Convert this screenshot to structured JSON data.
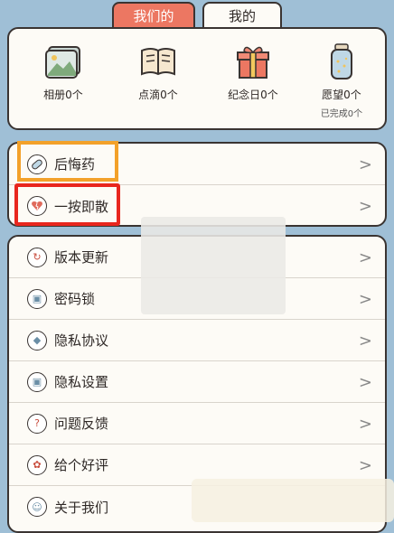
{
  "tabs": {
    "active": "我们的",
    "inactive": "我的"
  },
  "stats": [
    {
      "label": "相册0个",
      "icon": "photo-album-icon"
    },
    {
      "label": "点滴0个",
      "icon": "book-icon"
    },
    {
      "label": "纪念日0个",
      "icon": "gift-icon"
    },
    {
      "label": "愿望0个",
      "sub": "已完成0个",
      "icon": "wish-jar-icon"
    }
  ],
  "mid_rows": [
    {
      "label": "后悔药",
      "icon": "pill-icon"
    },
    {
      "label": "一按即散",
      "icon": "broken-heart-icon"
    }
  ],
  "menu_rows": [
    {
      "label": "版本更新",
      "icon": "update-icon"
    },
    {
      "label": "密码锁",
      "icon": "lock-icon"
    },
    {
      "label": "隐私协议",
      "icon": "shield-icon"
    },
    {
      "label": "隐私设置",
      "icon": "privacy-lock-icon"
    },
    {
      "label": "问题反馈",
      "icon": "question-icon"
    },
    {
      "label": "给个好评",
      "icon": "flower-icon"
    },
    {
      "label": "关于我们",
      "icon": "people-icon"
    }
  ],
  "chevron": ">",
  "colors": {
    "accent": "#ec7762",
    "background": "#9fbfd6",
    "highlight_orange": "#f3a12a",
    "highlight_red": "#e8261e"
  }
}
